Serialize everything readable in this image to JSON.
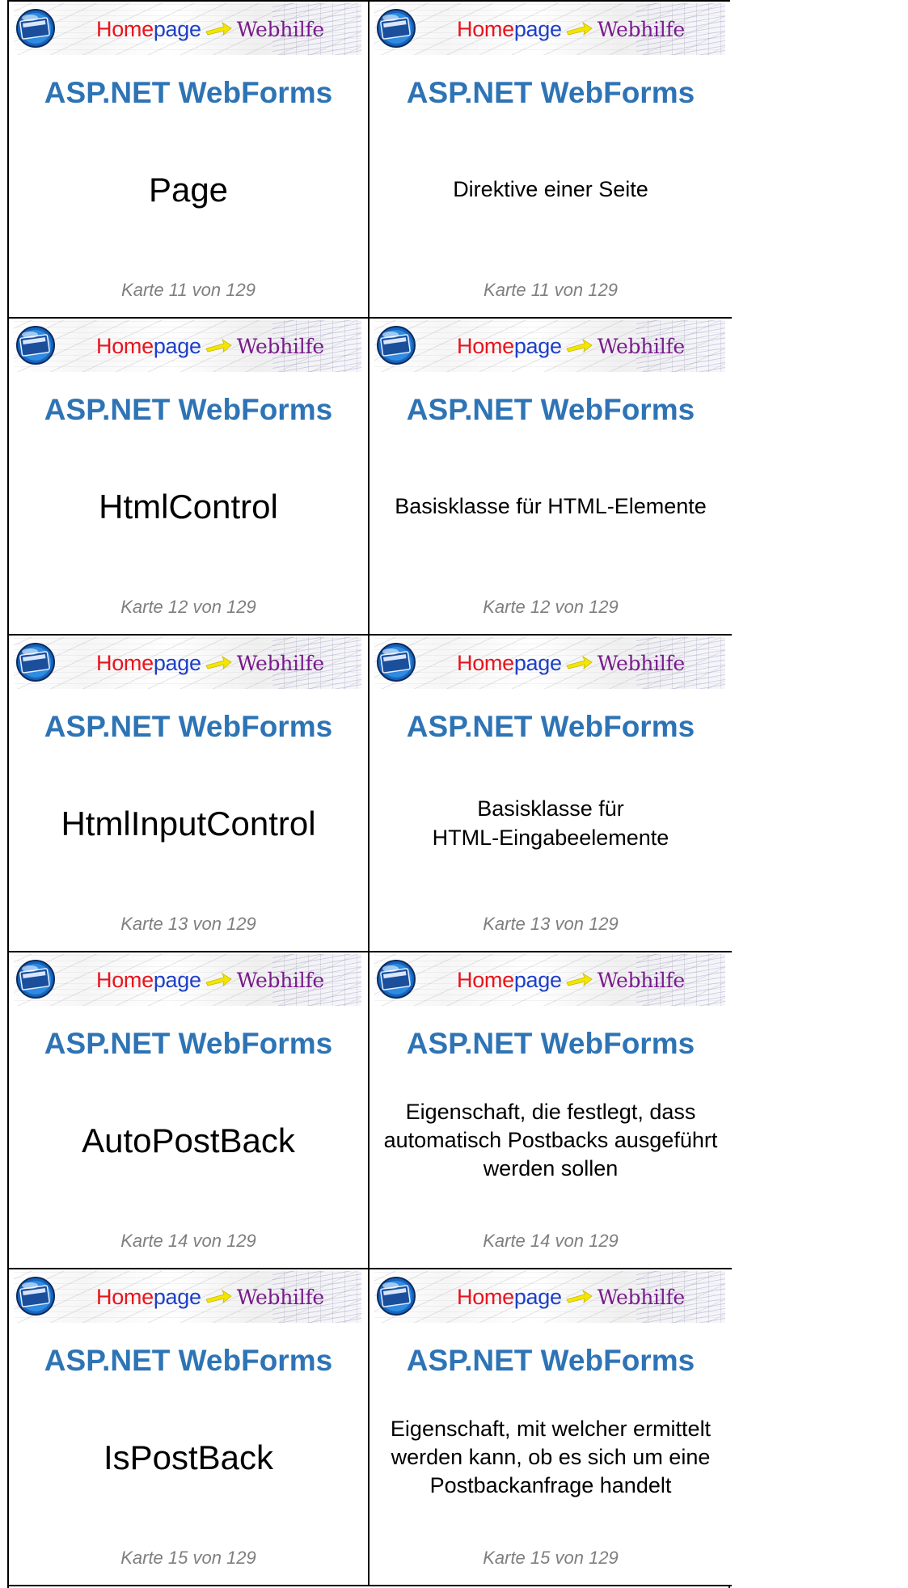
{
  "banner": {
    "homepage_part1": "Home",
    "homepage_part2": "page",
    "webhilfe": "Webhilfe"
  },
  "colors": {
    "heading": "#2e74b5",
    "footer": "#7f7f7f",
    "home": "#e8141c",
    "page": "#1d3fc8",
    "webhilfe": "#7a1a8c",
    "arrow": "#f3e600"
  },
  "cards": [
    {
      "heading": "ASP.NET WebForms",
      "term": "Page",
      "definition": "Direktive einer Seite",
      "footer": "Karte 11 von 129"
    },
    {
      "heading": "ASP.NET WebForms",
      "term": "HtmlControl",
      "definition": "Basisklasse für HTML-Elemente",
      "footer": "Karte 12 von 129"
    },
    {
      "heading": "ASP.NET WebForms",
      "term": "HtmlInputControl",
      "definition": "Basisklasse für\nHTML-Eingabeelemente",
      "footer": "Karte 13 von 129"
    },
    {
      "heading": "ASP.NET WebForms",
      "term": "AutoPostBack",
      "definition": "Eigenschaft, die festlegt, dass automatisch Postbacks ausgeführt werden sollen",
      "footer": "Karte 14 von 129"
    },
    {
      "heading": "ASP.NET WebForms",
      "term": "IsPostBack",
      "definition": "Eigenschaft, mit welcher ermittelt werden kann, ob es sich um eine Postbackanfrage handelt",
      "footer": "Karte 15 von 129"
    }
  ]
}
